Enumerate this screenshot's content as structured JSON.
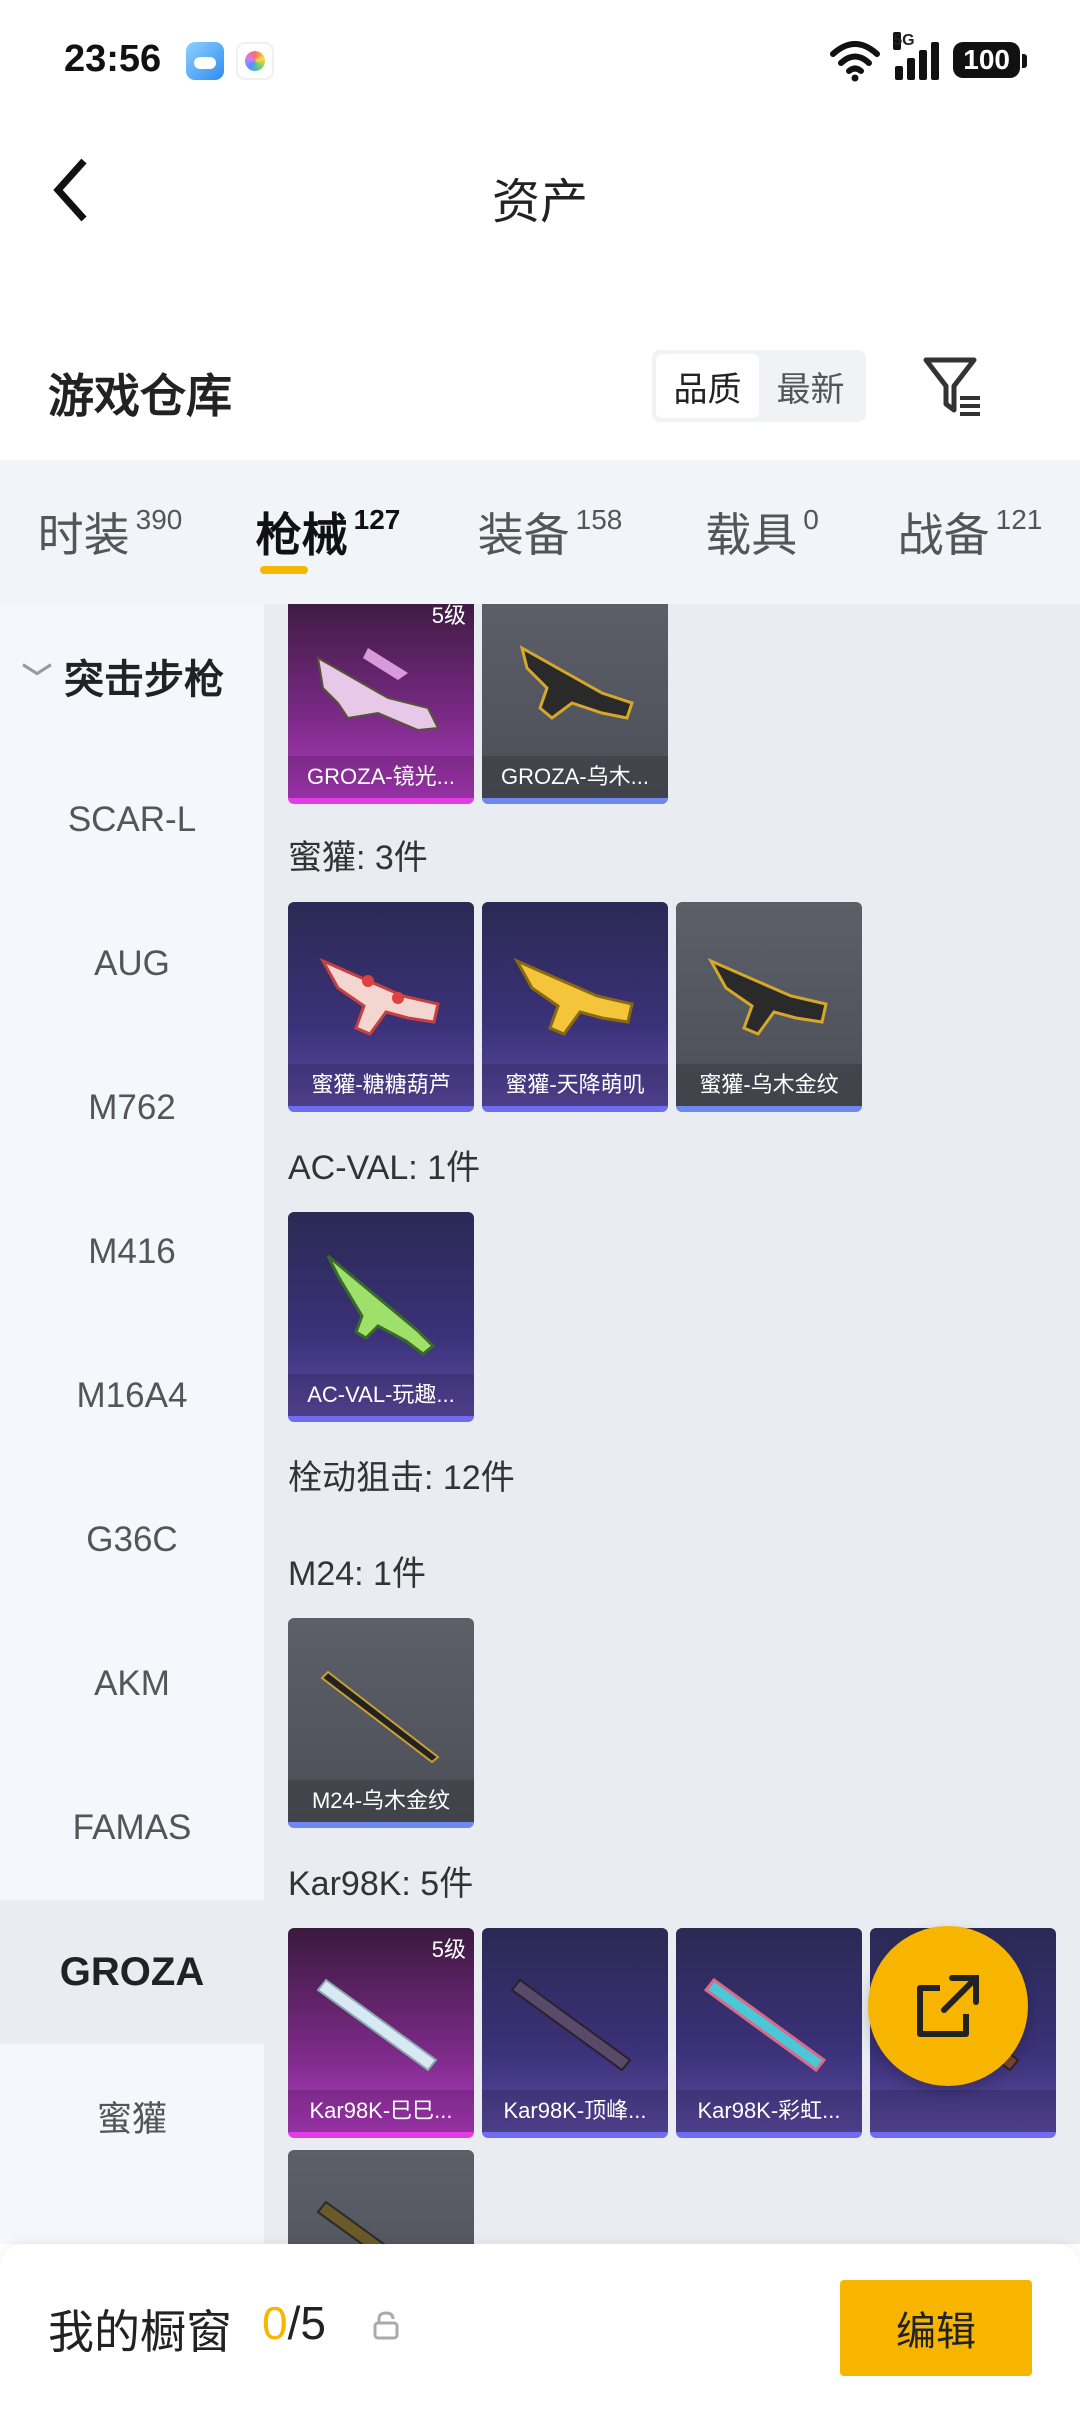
{
  "status_bar": {
    "time": "23:56",
    "network": "5G",
    "battery": "100"
  },
  "header": {
    "title": "资产"
  },
  "warehouse": {
    "title": "游戏仓库",
    "sort_options": [
      "品质",
      "最新"
    ],
    "sort_selected": "品质"
  },
  "tabs": [
    {
      "label": "时装",
      "count": "390"
    },
    {
      "label": "枪械",
      "count": "127",
      "active": true
    },
    {
      "label": "装备",
      "count": "158"
    },
    {
      "label": "载具",
      "count": "0"
    },
    {
      "label": "战备",
      "count": "121"
    }
  ],
  "sidebar": {
    "category": "突击步枪",
    "items": [
      "SCAR-L",
      "AUG",
      "M762",
      "M416",
      "M16A4",
      "G36C",
      "AKM",
      "FAMAS",
      "GROZA",
      "蜜獾"
    ],
    "active": "GROZA"
  },
  "content": {
    "groza_items": [
      {
        "name": "GROZA-镜光...",
        "level": "5级",
        "rarity": "gold"
      },
      {
        "name": "GROZA-乌木...",
        "rarity": "grey"
      }
    ],
    "honeybadger": {
      "title": "蜜獾: 3件",
      "items": [
        {
          "name": "蜜獾-糖糖葫芦",
          "rarity": "purple"
        },
        {
          "name": "蜜獾-天降萌叽",
          "rarity": "purple"
        },
        {
          "name": "蜜獾-乌木金纹",
          "rarity": "grey"
        }
      ]
    },
    "acval": {
      "title": "AC-VAL: 1件",
      "items": [
        {
          "name": "AC-VAL-玩趣...",
          "rarity": "purple"
        }
      ]
    },
    "sniper_title": "栓动狙击: 12件",
    "m24": {
      "title": "M24: 1件",
      "items": [
        {
          "name": "M24-乌木金纹",
          "rarity": "grey"
        }
      ]
    },
    "kar98k": {
      "title": "Kar98K: 5件",
      "items": [
        {
          "name": "Kar98K-巳巳...",
          "level": "5级",
          "rarity": "gold"
        },
        {
          "name": "Kar98K-顶峰...",
          "rarity": "purple"
        },
        {
          "name": "Kar98K-彩虹...",
          "rarity": "purple"
        },
        {
          "name": "",
          "rarity": "purple"
        }
      ]
    }
  },
  "bottom_bar": {
    "showcase_label": "我的橱窗",
    "showcase_current": "0",
    "showcase_total": "/5",
    "edit_label": "编辑"
  },
  "colors": {
    "accent": "#f7b500",
    "tab_bg": "#f1f4f9",
    "content_bg": "#e9ecf1"
  }
}
